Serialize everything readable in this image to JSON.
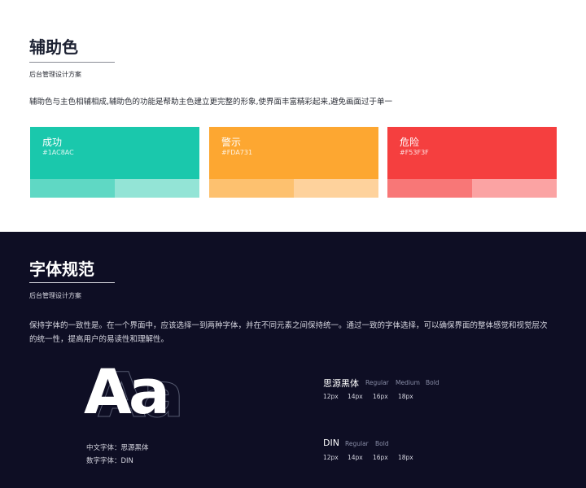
{
  "palette_section": {
    "title": "辅助色",
    "subtitle": "后台管理设计方案",
    "description": "辅助色与主色相辅相成,辅助色的功能是帮助主色建立更完整的形象,使界面丰富精彩起来,避免画面过于单一",
    "cards": [
      {
        "name": "成功",
        "hex": "#1AC8AC",
        "color": "#1AC8AC",
        "tint1": "#5fd8c4",
        "tint2": "#93e4d6"
      },
      {
        "name": "警示",
        "hex": "#FDA731",
        "color": "#FDA731",
        "tint1": "#fdc16f",
        "tint2": "#fed29c"
      },
      {
        "name": "危险",
        "hex": "#F53F3F",
        "color": "#F53F3F",
        "tint1": "#f87777",
        "tint2": "#fba3a3"
      }
    ]
  },
  "typography_section": {
    "title": "字体规范",
    "subtitle": "后台管理设计方案",
    "description_line1": "保持字体的一致性是。在一个界面中，应该选择一到两种字体，并在不同元素之间保持统一。通过一致的字体选择，可以确保界面的整体感觉和视觉层次",
    "description_line2": "的统一性，提高用户的易读性和理解性。",
    "sample_glyphs": "Aa",
    "chinese_font_note": "中文字体：思源黑体",
    "number_font_note": "数字字体：DIN",
    "specs": [
      {
        "name": "思源黑体",
        "weights": [
          "Regular",
          "Medium",
          "Bold"
        ],
        "sizes": [
          "12px",
          "14px",
          "16px",
          "18px"
        ]
      },
      {
        "name": "DIN",
        "weights": [
          "Regular",
          "Bold"
        ],
        "sizes": [
          "12px",
          "14px",
          "16px",
          "18px"
        ]
      }
    ]
  }
}
